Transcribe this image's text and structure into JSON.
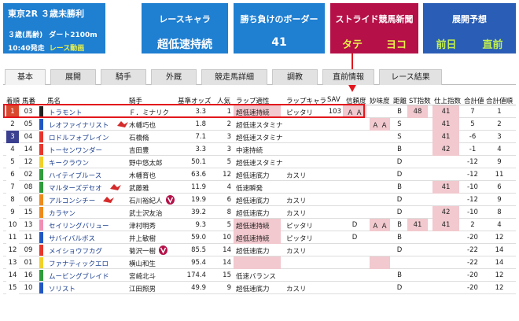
{
  "race": {
    "title": "東京2R ３歳未勝利",
    "age": "３歳(馬齢)",
    "course": "ダート2100m",
    "time": "10:40発走",
    "video": "レース動画"
  },
  "cards": {
    "race_chara_label": "レースキャラ",
    "race_chara_value": "超低速持続",
    "border_label": "勝ち負けのボーダー",
    "border_value": "41",
    "stride_label": "ストライド競馬新聞",
    "stride_left": "タテ",
    "stride_right": "ヨコ",
    "expect_label": "展開予想",
    "expect_left": "前日",
    "expect_right": "直前"
  },
  "tabs": [
    "基本",
    "展開",
    "騎手",
    "外厩",
    "競走馬詳細",
    "調教",
    "直前情報",
    "レース結果"
  ],
  "headers": {
    "waku": "着順",
    "num": "馬番",
    "name": "馬名",
    "jockey": "騎手",
    "odds": "基準オッズ",
    "pop": "人気",
    "lap": "ラップ適性",
    "chara": "ラップキャラ",
    "sav": "SAV",
    "rel": "信頼度",
    "myo": "妙味度",
    "aff": "距離",
    "st": "ST指数",
    "fin": "仕上指数",
    "tot": "合計値",
    "tot2": "合計値順"
  },
  "colors": {
    "waku": [
      "#ffffff",
      "#222222",
      "#e8352b",
      "#1f56c4",
      "#f2d02a",
      "#2e9c3b",
      "#ee8a1b",
      "#f08fb4"
    ],
    "highlight": "#f1c9ce",
    "box": "#e2161c"
  },
  "rows": [
    {
      "waku": "1",
      "waku_bg": "#d9492e",
      "waku_fg": "#ffffff",
      "num": "03",
      "strip": "#222222",
      "name": "トラモント",
      "flag": false,
      "jockey": "Ｆ．ミナリク",
      "vmark": false,
      "odds": "3.3",
      "pop": "1",
      "lap": "超低速持続",
      "lap_hl": true,
      "chara": "ピッタリ",
      "sav": "103",
      "rel": "Ａ Ａ",
      "rel_hl": true,
      "myo": "",
      "myo_hl": false,
      "aff": "B",
      "st": "48",
      "st_hl": true,
      "fin": "41",
      "fin_hl": true,
      "tot": "7",
      "tot2": "1"
    },
    {
      "waku": "2",
      "waku_bg": "#ffffff",
      "waku_fg": "#222222",
      "num": "05",
      "strip": "#1f56c4",
      "name": "レオファイナリスト",
      "flag": true,
      "jockey": "木幡巧也",
      "vmark": false,
      "odds": "1.8",
      "pop": "2",
      "lap": "超低速スタミナ",
      "lap_hl": false,
      "chara": "",
      "sav": "",
      "rel": "",
      "rel_hl": false,
      "myo": "Ａ Ａ",
      "myo_hl": true,
      "aff": "S",
      "st": "",
      "st_hl": false,
      "fin": "41",
      "fin_hl": true,
      "tot": "5",
      "tot2": "2"
    },
    {
      "waku": "3",
      "waku_bg": "#3a3f8f",
      "waku_fg": "#ffffff",
      "num": "04",
      "strip": "#e8352b",
      "name": "ロドルフォプレイン",
      "flag": false,
      "jockey": "石橋脩",
      "vmark": false,
      "odds": "7.1",
      "pop": "3",
      "lap": "超低速スタミナ",
      "lap_hl": false,
      "chara": "",
      "sav": "",
      "rel": "",
      "rel_hl": false,
      "myo": "",
      "myo_hl": false,
      "aff": "S",
      "st": "",
      "st_hl": false,
      "fin": "41",
      "fin_hl": true,
      "tot": "-6",
      "tot2": "3"
    },
    {
      "waku": "4",
      "waku_bg": "#ffffff",
      "waku_fg": "#222222",
      "num": "14",
      "strip": "#e8352b",
      "name": "トーセンワンダー",
      "flag": false,
      "jockey": "吉田豊",
      "vmark": false,
      "odds": "3.3",
      "pop": "3",
      "lap": "中速持続",
      "lap_hl": false,
      "chara": "",
      "sav": "",
      "rel": "",
      "rel_hl": false,
      "myo": "",
      "myo_hl": false,
      "aff": "B",
      "st": "",
      "st_hl": false,
      "fin": "42",
      "fin_hl": true,
      "tot": "-1",
      "tot2": "4"
    },
    {
      "waku": "5",
      "waku_bg": "#ffffff",
      "waku_fg": "#222222",
      "num": "12",
      "strip": "#f2d02a",
      "name": "キークラウン",
      "flag": false,
      "jockey": "野中悠太郎",
      "vmark": false,
      "odds": "50.1",
      "pop": "5",
      "lap": "超低速スタミナ",
      "lap_hl": false,
      "chara": "",
      "sav": "",
      "rel": "",
      "rel_hl": false,
      "myo": "",
      "myo_hl": false,
      "aff": "D",
      "st": "",
      "st_hl": false,
      "fin": "",
      "fin_hl": false,
      "tot": "-12",
      "tot2": "9"
    },
    {
      "waku": "6",
      "waku_bg": "#ffffff",
      "waku_fg": "#222222",
      "num": "02",
      "strip": "#2e9c3b",
      "name": "ハイテイブルース",
      "flag": false,
      "jockey": "木幡育也",
      "vmark": false,
      "odds": "63.6",
      "pop": "12",
      "lap": "超低速底力",
      "lap_hl": false,
      "chara": "カスリ",
      "sav": "",
      "rel": "",
      "rel_hl": false,
      "myo": "",
      "myo_hl": false,
      "aff": "D",
      "st": "",
      "st_hl": false,
      "fin": "",
      "fin_hl": false,
      "tot": "-12",
      "tot2": "11"
    },
    {
      "waku": "7",
      "waku_bg": "#ffffff",
      "waku_fg": "#222222",
      "num": "08",
      "strip": "#2e9c3b",
      "name": "マルターズデセオ",
      "flag": true,
      "jockey": "武藤雅",
      "vmark": false,
      "odds": "11.9",
      "pop": "4",
      "lap": "低速瞬発",
      "lap_hl": false,
      "chara": "",
      "sav": "",
      "rel": "",
      "rel_hl": false,
      "myo": "",
      "myo_hl": false,
      "aff": "B",
      "st": "",
      "st_hl": false,
      "fin": "41",
      "fin_hl": true,
      "tot": "-10",
      "tot2": "6"
    },
    {
      "waku": "8",
      "waku_bg": "#ffffff",
      "waku_fg": "#222222",
      "num": "06",
      "strip": "#ee8a1b",
      "name": "アルコンシチー",
      "flag": true,
      "jockey": "石川裕紀人",
      "vmark": true,
      "odds": "19.9",
      "pop": "6",
      "lap": "超低速底力",
      "lap_hl": false,
      "chara": "カスリ",
      "sav": "",
      "rel": "",
      "rel_hl": false,
      "myo": "",
      "myo_hl": false,
      "aff": "D",
      "st": "",
      "st_hl": false,
      "fin": "",
      "fin_hl": false,
      "tot": "-12",
      "tot2": "9"
    },
    {
      "waku": "9",
      "waku_bg": "#ffffff",
      "waku_fg": "#222222",
      "num": "15",
      "strip": "#ee8a1b",
      "name": "カラヤン",
      "flag": false,
      "jockey": "武士沢友治",
      "vmark": false,
      "odds": "39.2",
      "pop": "8",
      "lap": "超低速底力",
      "lap_hl": false,
      "chara": "カスリ",
      "sav": "",
      "rel": "",
      "rel_hl": false,
      "myo": "",
      "myo_hl": false,
      "aff": "D",
      "st": "",
      "st_hl": false,
      "fin": "42",
      "fin_hl": true,
      "tot": "-10",
      "tot2": "8"
    },
    {
      "waku": "10",
      "waku_bg": "#ffffff",
      "waku_fg": "#222222",
      "num": "13",
      "strip": "#f08fb4",
      "name": "セイリングバリュー",
      "flag": false,
      "jockey": "津村明秀",
      "vmark": false,
      "odds": "9.3",
      "pop": "5",
      "lap": "超低速持続",
      "lap_hl": true,
      "chara": "ピッタリ",
      "sav": "",
      "rel": "D",
      "rel_hl": false,
      "myo": "Ａ Ａ",
      "myo_hl": true,
      "aff": "B",
      "st": "41",
      "st_hl": true,
      "fin": "41",
      "fin_hl": true,
      "tot": "2",
      "tot2": "4"
    },
    {
      "waku": "11",
      "waku_bg": "#ffffff",
      "waku_fg": "#222222",
      "num": "11",
      "strip": "#1f56c4",
      "name": "サバイバルボス",
      "flag": false,
      "jockey": "井上敏樹",
      "vmark": false,
      "odds": "59.0",
      "pop": "10",
      "lap": "超低速持続",
      "lap_hl": true,
      "chara": "ピッタリ",
      "sav": "",
      "rel": "D",
      "rel_hl": false,
      "myo": "",
      "myo_hl": false,
      "aff": "B",
      "st": "",
      "st_hl": false,
      "fin": "",
      "fin_hl": false,
      "tot": "-20",
      "tot2": "12"
    },
    {
      "waku": "12",
      "waku_bg": "#ffffff",
      "waku_fg": "#222222",
      "num": "09",
      "strip": "#e8352b",
      "name": "メイショウフカグ",
      "flag": false,
      "jockey": "菊沢一樹",
      "vmark": true,
      "odds": "85.5",
      "pop": "14",
      "lap": "超低速底力",
      "lap_hl": false,
      "chara": "カスリ",
      "sav": "",
      "rel": "",
      "rel_hl": false,
      "myo": "",
      "myo_hl": false,
      "aff": "D",
      "st": "",
      "st_hl": false,
      "fin": "",
      "fin_hl": false,
      "tot": "-22",
      "tot2": "14"
    },
    {
      "waku": "13",
      "waku_bg": "#ffffff",
      "waku_fg": "#222222",
      "num": "01",
      "strip": "#f2d02a",
      "name": "ファナティックエロ",
      "flag": false,
      "jockey": "横山和生",
      "vmark": false,
      "odds": "95.4",
      "pop": "14",
      "lap": "",
      "lap_hl": true,
      "chara": "",
      "sav": "",
      "rel": "",
      "rel_hl": false,
      "myo": "",
      "myo_hl": true,
      "aff": "",
      "st": "",
      "st_hl": false,
      "fin": "",
      "fin_hl": false,
      "tot": "-22",
      "tot2": "14"
    },
    {
      "waku": "14",
      "waku_bg": "#ffffff",
      "waku_fg": "#222222",
      "num": "16",
      "strip": "#2e9c3b",
      "name": "ムービングブレイド",
      "flag": false,
      "jockey": "宮崎北斗",
      "vmark": false,
      "odds": "174.4",
      "pop": "15",
      "lap": "低速バランス",
      "lap_hl": false,
      "chara": "",
      "sav": "",
      "rel": "",
      "rel_hl": false,
      "myo": "",
      "myo_hl": false,
      "aff": "B",
      "st": "",
      "st_hl": false,
      "fin": "",
      "fin_hl": false,
      "tot": "-20",
      "tot2": "12"
    },
    {
      "waku": "15",
      "waku_bg": "#ffffff",
      "waku_fg": "#222222",
      "num": "10",
      "strip": "#1f56c4",
      "name": "ソリスト",
      "flag": false,
      "jockey": "江田照男",
      "vmark": false,
      "odds": "49.9",
      "pop": "9",
      "lap": "超低速底力",
      "lap_hl": false,
      "chara": "カスリ",
      "sav": "",
      "rel": "",
      "rel_hl": false,
      "myo": "",
      "myo_hl": false,
      "aff": "D",
      "st": "",
      "st_hl": false,
      "fin": "",
      "fin_hl": false,
      "tot": "-20",
      "tot2": "12"
    }
  ]
}
